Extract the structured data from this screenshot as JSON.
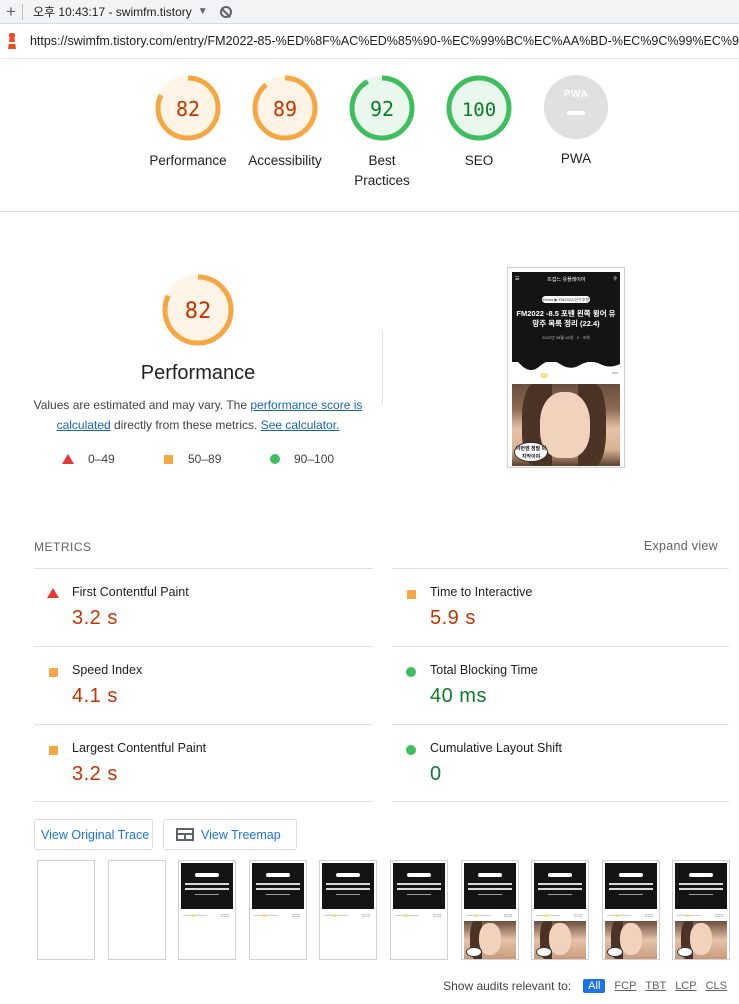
{
  "browser": {
    "tab_title": "오후 10:43:17 - swimfm.tistory",
    "url": "https://swimfm.tistory.com/entry/FM2022-85-%ED%8F%AC%ED%85%90-%EC%99%BC%EC%AA%BD-%EC%9C%99%EC%96%B4-%..."
  },
  "gauges": [
    {
      "label": "Performance",
      "score": "82",
      "value": 82,
      "status": "average"
    },
    {
      "label": "Accessibility",
      "score": "89",
      "value": 89,
      "status": "average"
    },
    {
      "label": "Best Practices",
      "score": "92",
      "value": 92,
      "status": "pass"
    },
    {
      "label": "SEO",
      "score": "100",
      "value": 100,
      "status": "pass"
    },
    {
      "label": "PWA",
      "badge_text": "PWA"
    }
  ],
  "colors": {
    "average": "#f4a742",
    "average_bg": "#fff4e5",
    "average_text": "#c33300",
    "pass": "#3fbe5e",
    "pass_bg": "#e9f7ec",
    "pass_text": "#0b7d2a",
    "fail": "#e53935",
    "link": "#1a73e8"
  },
  "performance": {
    "score": "82",
    "value": 82,
    "title": "Performance",
    "desc_prefix": "Values are estimated and may vary. The ",
    "desc_link1": "performance score is calculated",
    "desc_middle": " directly from these metrics. ",
    "desc_link2": "See calculator."
  },
  "legend": [
    {
      "icon": "triangle",
      "range": "0–49"
    },
    {
      "icon": "square",
      "range": "50–89"
    },
    {
      "icon": "circle",
      "range": "90–100"
    }
  ],
  "screenshot": {
    "site_name": "뜨겁느 유플레이어",
    "breadcrumb": "Home ▶ FM2022/선수추천",
    "headline": "FM2022 -8.5 포텐 왼쪽 윙어 유망주 목록 정리 (22.4)",
    "meta": "2022년 08월 18일 · 0 · 조회",
    "speech": "이번엔 정말 마지막이야"
  },
  "metrics": {
    "header": "METRICS",
    "expand_label": "Expand view",
    "items": [
      {
        "name": "First Contentful Paint",
        "value": "3.2 s",
        "status": "fail"
      },
      {
        "name": "Time to Interactive",
        "value": "5.9 s",
        "status": "average"
      },
      {
        "name": "Speed Index",
        "value": "4.1 s",
        "status": "average"
      },
      {
        "name": "Total Blocking Time",
        "value": "40 ms",
        "status": "pass"
      },
      {
        "name": "Largest Contentful Paint",
        "value": "3.2 s",
        "status": "average"
      },
      {
        "name": "Cumulative Layout Shift",
        "value": "0",
        "status": "pass"
      }
    ]
  },
  "buttons": {
    "view_trace": "View Original Trace",
    "view_treemap": "View Treemap"
  },
  "filmstrip": {
    "frames": [
      "blank",
      "blank",
      "header",
      "header",
      "header",
      "header",
      "full",
      "full",
      "full",
      "full"
    ]
  },
  "footer": {
    "label": "Show audits relevant to:",
    "filters": [
      "All",
      "FCP",
      "TBT",
      "LCP",
      "CLS"
    ],
    "active": "All"
  }
}
